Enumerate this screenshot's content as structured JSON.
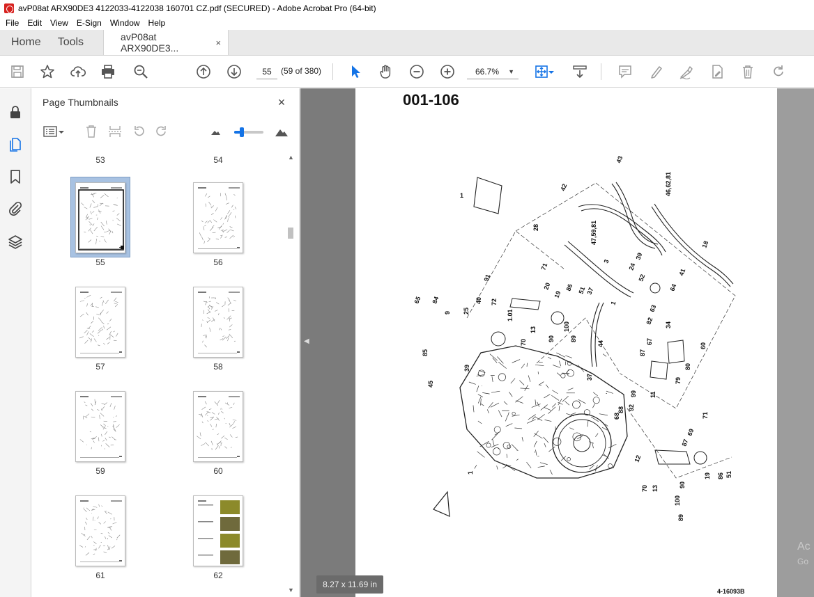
{
  "window": {
    "title": "avP08at ARX90DE3 4122033-4122038 160701 CZ.pdf (SECURED) - Adobe Acrobat Pro (64-bit)"
  },
  "menu": [
    "File",
    "Edit",
    "View",
    "E-Sign",
    "Window",
    "Help"
  ],
  "tabs": {
    "home": "Home",
    "tools": "Tools",
    "document": "avP08at ARX90DE3...",
    "close": "×"
  },
  "toolbar": {
    "page_number": "55",
    "page_count": "(59 of 380)",
    "zoom": "66.7%",
    "icons": [
      "save-icon",
      "star-icon",
      "upload-icon",
      "print-icon",
      "zoom-search-icon",
      "page-up-icon",
      "page-down-icon",
      "cursor-icon",
      "hand-icon",
      "zoom-out-icon",
      "zoom-in-icon",
      "fit-page-icon",
      "scroll-mode-icon",
      "comment-icon",
      "highlight-icon",
      "sign-icon",
      "edit-pdf-icon",
      "delete-icon",
      "redo-icon"
    ]
  },
  "rail": [
    "lock-icon",
    "pages-icon",
    "bookmark-icon",
    "attachment-icon",
    "layers-icon"
  ],
  "thumbnails": {
    "title": "Page Thumbnails",
    "close": "×",
    "slider_value": 0.25,
    "pages": [
      {
        "label": "53"
      },
      {
        "label": "54"
      },
      {
        "label": "55",
        "selected": true
      },
      {
        "label": "56"
      },
      {
        "label": "57"
      },
      {
        "label": "58"
      },
      {
        "label": "59"
      },
      {
        "label": "60"
      },
      {
        "label": "61"
      },
      {
        "label": "62"
      }
    ]
  },
  "document": {
    "heading": "001-106",
    "figure_ref": "4-16093B",
    "page_size": "8.27 x 11.69 in",
    "watermark": [
      "Ac",
      "Go"
    ],
    "callouts": [
      "1",
      "42",
      "43",
      "46,62,81",
      "28",
      "47,59,81",
      "18",
      "39",
      "41",
      "3",
      "24",
      "52",
      "64",
      "91",
      "71",
      "20",
      "86",
      "51",
      "37",
      "1",
      "63",
      "65",
      "84",
      "25",
      "40",
      "72",
      "1.01",
      "19",
      "82",
      "9",
      "13",
      "70",
      "100",
      "90",
      "89",
      "34",
      "67",
      "85",
      "44",
      "87",
      "79",
      "80",
      "60",
      "45",
      "39",
      "37",
      "99",
      "92",
      "11",
      "88",
      "68",
      "71",
      "69",
      "87",
      "12",
      "19",
      "86",
      "51",
      "70",
      "13",
      "90",
      "89",
      "100",
      "1"
    ]
  }
}
